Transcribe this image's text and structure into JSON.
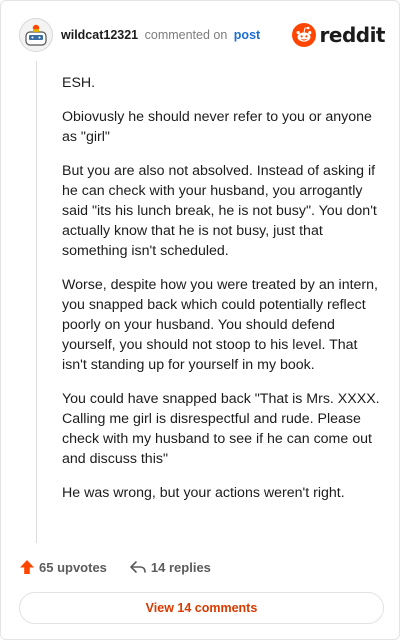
{
  "header": {
    "username": "wildcat12321",
    "action_text": "commented on",
    "link_text": "post",
    "logo_text": "reddit"
  },
  "comment": {
    "paragraphs": [
      "ESH.",
      "Obiovusly he should never refer to you or anyone as \"girl\"",
      "But you are also not absolved. Instead of asking if he can check with your husband, you arrogantly said \"its his lunch break, he is not busy\". You don't actually know that he is not busy, just that something isn't scheduled.",
      "Worse, despite how you were treated by an intern, you snapped back which could potentially reflect poorly on your husband. You should defend yourself, you should not stoop to his level. That isn't standing up for yourself in my book.",
      "You could have snapped back \"That is Mrs. XXXX. Calling me girl is disrespectful and rude. Please check with my husband to see if he can come out and discuss this\"",
      "He was wrong, but your actions weren't right."
    ]
  },
  "footer": {
    "upvotes": "65 upvotes",
    "replies": "14 replies",
    "view_comments": "View 14 comments"
  },
  "colors": {
    "accent": "#ff4500",
    "link": "#1c6fd6",
    "cta": "#d93a00"
  },
  "icons": {
    "avatar": "reddit-snoo-avatar-icon",
    "logo": "reddit-logo-icon",
    "upvote": "upvote-arrow-icon",
    "reply": "reply-arrow-icon"
  }
}
